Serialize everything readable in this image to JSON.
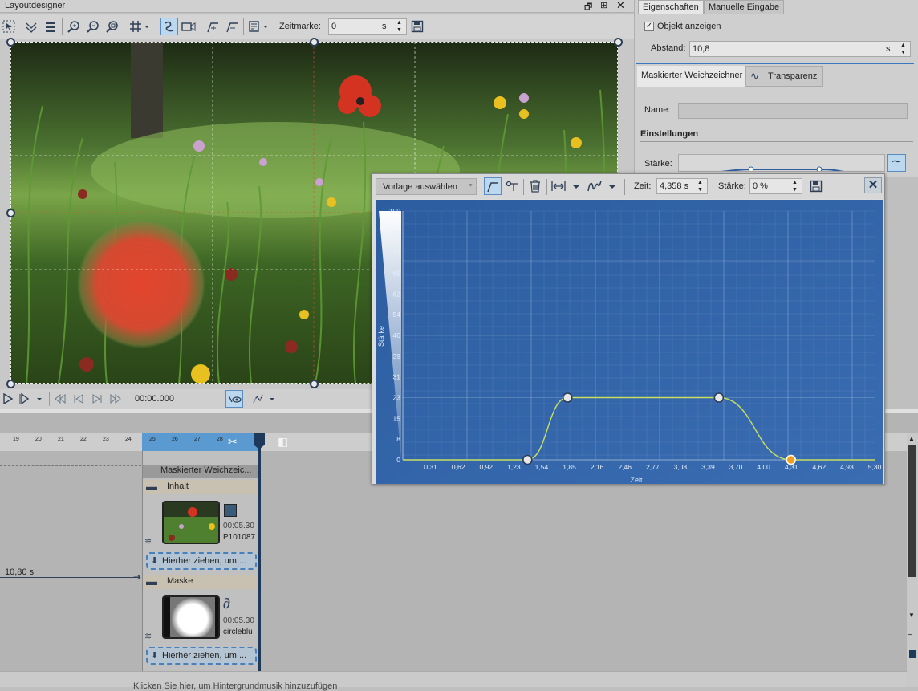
{
  "layoutdesigner": {
    "title": "Layoutdesigner",
    "zeitmarke_label": "Zeitmarke:",
    "zeitmarke_value": "0",
    "zeitmarke_unit": "s",
    "time_display": "00:00.000"
  },
  "properties": {
    "tabs": [
      "Eigenschaften",
      "Manuelle Eingabe"
    ],
    "objekt_anzeigen_label": "Objekt anzeigen",
    "objekt_anzeigen_checked": true,
    "abstand_label": "Abstand:",
    "abstand_value": "10,8",
    "abstand_unit": "s",
    "subtabs": [
      "Maskierter Weichzeichner",
      "Transparenz"
    ],
    "name_label": "Name:",
    "name_value": "",
    "einstellungen_label": "Einstellungen",
    "staerke_label": "Stärke:"
  },
  "curve_editor": {
    "vorlage_label": "Vorlage auswählen",
    "zeit_label": "Zeit:",
    "zeit_value": "4,358 s",
    "staerke_label": "Stärke:",
    "staerke_value": "0 %",
    "y_axis_label": "Stärke",
    "x_axis_label": "Zeit",
    "y_ticks": [
      "100",
      "85",
      "77",
      "69",
      "62",
      "54",
      "46",
      "39",
      "31",
      "23",
      "15",
      "8",
      "0"
    ],
    "x_ticks": [
      "0,31",
      "0,62",
      "0,92",
      "1,23",
      "1,54",
      "1,85",
      "2,16",
      "2,46",
      "2,77",
      "3,08",
      "3,39",
      "3,70",
      "4,00",
      "4,31",
      "4,62",
      "4,93",
      "5,30"
    ],
    "accent": "#f0a020",
    "curve_color": "#c8e060"
  },
  "chart_data": {
    "type": "line",
    "xlabel": "Zeit",
    "ylabel": "Stärke",
    "xlim": [
      0,
      5.3
    ],
    "ylim": [
      0,
      100
    ],
    "keyframes": [
      {
        "x": 1.4,
        "y": 0
      },
      {
        "x": 1.85,
        "y": 25
      },
      {
        "x": 3.55,
        "y": 25
      },
      {
        "x": 4.36,
        "y": 0,
        "selected": true
      }
    ]
  },
  "timeline": {
    "ruler_ticks": [
      "19",
      "20",
      "21",
      "22",
      "23",
      "24",
      "25",
      "26",
      "27",
      "28"
    ],
    "track_label": "Maskierter Weichzeic...",
    "inhalt_label": "Inhalt",
    "inhalt_duration": "00:05.30",
    "inhalt_file": "P101087",
    "drop_hint": "Hierher ziehen, um ...",
    "maske_label": "Maske",
    "maske_duration": "00:05.30",
    "maske_file": "circleblu",
    "drop_hint_2": "Hierher ziehen, um ...",
    "distance_marker": "10,80 s",
    "music_hint": "Klicken Sie hier, um Hintergrundmusik hinzuzufügen"
  }
}
